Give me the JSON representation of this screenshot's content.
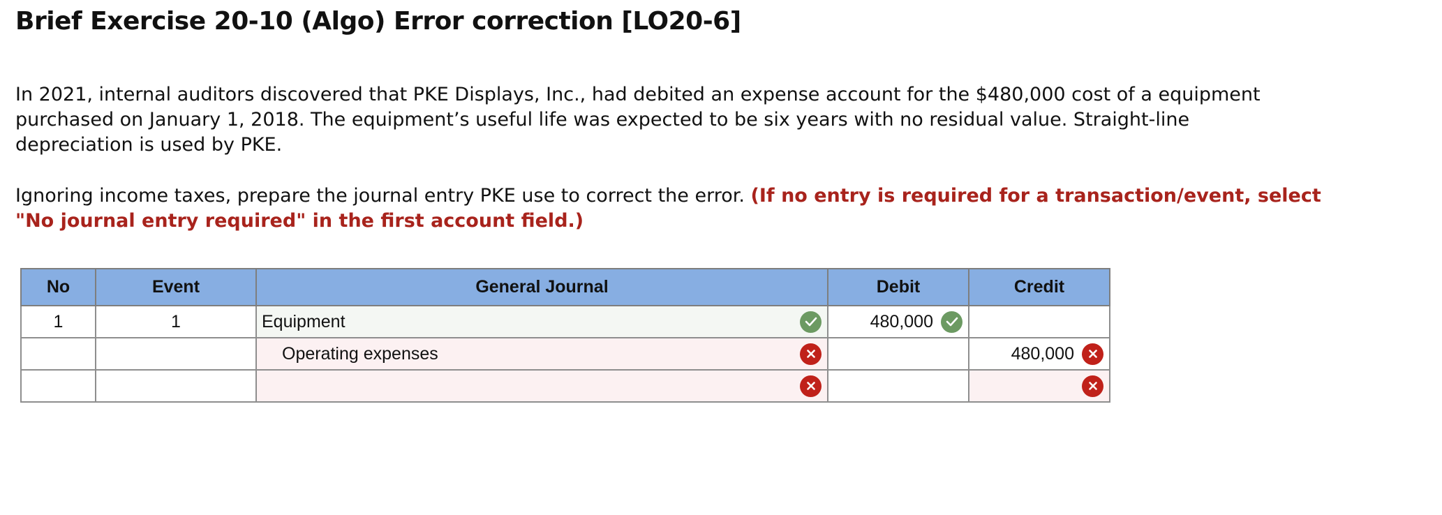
{
  "title": "Brief Exercise 20-10 (Algo) Error correction [LO20-6]",
  "intro": {
    "line1": "In 2021, internal auditors discovered that PKE Displays, Inc., had debited an expense account for the $480,000 cost of a equipment",
    "line2": "purchased on January 1, 2018. The equipment’s useful life was expected to be six years with no residual value. Straight-line",
    "line3": "depreciation is used by PKE."
  },
  "instruction": {
    "text": "Ignoring income taxes, prepare the journal entry PKE use to correct the error. ",
    "note_line1": "(If no entry is required for a transaction/event, select",
    "note_line2": "\"No journal entry required\" in the first account field.)"
  },
  "table": {
    "headers": {
      "no": "No",
      "event": "Event",
      "general_journal": "General Journal",
      "debit": "Debit",
      "credit": "Credit"
    },
    "rows": [
      {
        "no": "1",
        "event": "1",
        "account": "Equipment",
        "debit": "480,000",
        "credit": "",
        "account_status": "check-icon",
        "debit_status": "check-icon"
      },
      {
        "no": "",
        "event": "",
        "account": "Operating expenses",
        "debit": "",
        "credit": "480,000",
        "account_status": "cross-icon",
        "credit_status": "cross-icon"
      },
      {
        "no": "",
        "event": "",
        "account": "",
        "debit": "",
        "credit": "",
        "account_status": "cross-icon",
        "credit_status": "cross-icon"
      }
    ]
  },
  "colors": {
    "header_bg": "#87aee2",
    "correct": "#6c9a62",
    "incorrect": "#c0211a",
    "instruction_red": "#a8231c"
  }
}
